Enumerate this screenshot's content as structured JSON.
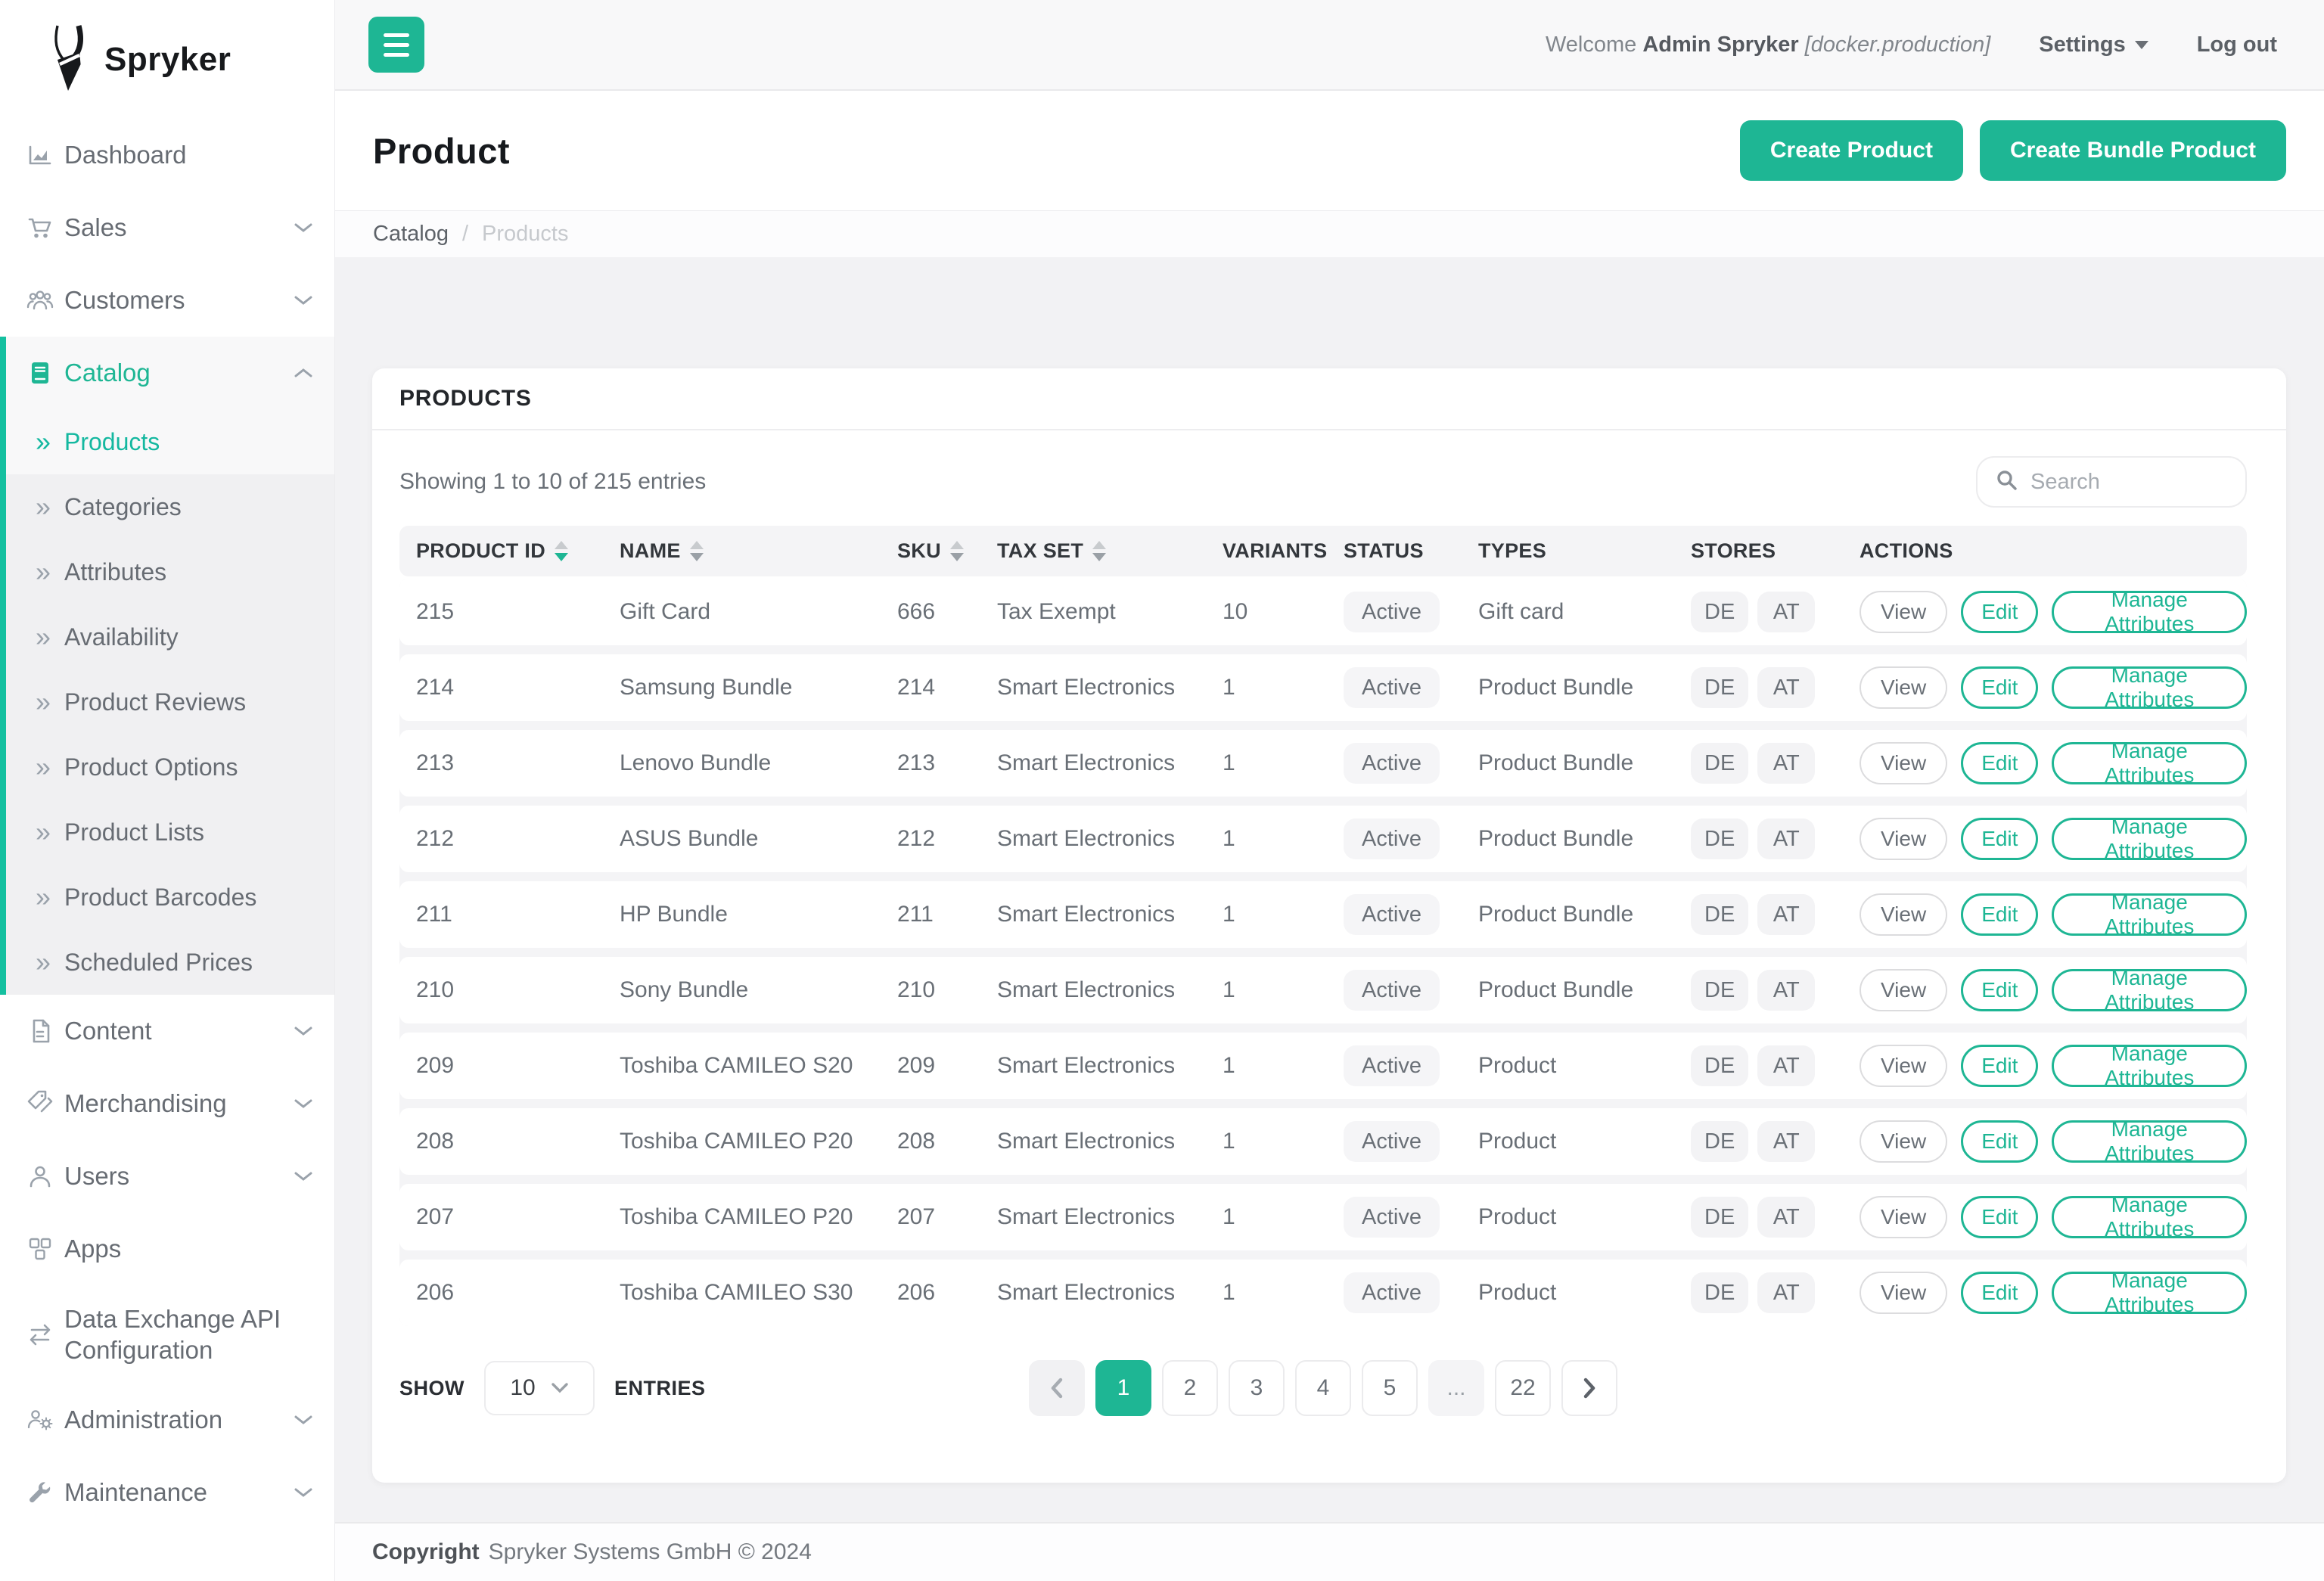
{
  "brand": {
    "logo_text": "Spryker",
    "accent_color": "#1EB694",
    "accent_bar_color": "#15c0a0"
  },
  "topbar": {
    "welcome_prefix": "Welcome",
    "user_name": "Admin Spryker",
    "environment": "[docker.production]",
    "settings_label": "Settings",
    "logout_label": "Log out"
  },
  "sidebar": {
    "top": [
      {
        "label": "Dashboard"
      },
      {
        "label": "Sales"
      },
      {
        "label": "Customers"
      }
    ],
    "catalog": {
      "label": "Catalog",
      "children": [
        {
          "label": "Products"
        },
        {
          "label": "Categories"
        },
        {
          "label": "Attributes"
        },
        {
          "label": "Availability"
        },
        {
          "label": "Product Reviews"
        },
        {
          "label": "Product Options"
        },
        {
          "label": "Product Lists"
        },
        {
          "label": "Product Barcodes"
        },
        {
          "label": "Scheduled Prices"
        }
      ]
    },
    "bottom": [
      {
        "label": "Content"
      },
      {
        "label": "Merchandising"
      },
      {
        "label": "Users"
      },
      {
        "label": "Apps"
      },
      {
        "label": "Data Exchange API Configuration"
      },
      {
        "label": "Administration"
      },
      {
        "label": "Maintenance"
      }
    ]
  },
  "page": {
    "title": "Product",
    "breadcrumb": {
      "parent": "Catalog",
      "separator": "/",
      "current": "Products"
    },
    "create_product_label": "Create Product",
    "create_bundle_label": "Create Bundle Product"
  },
  "panel": {
    "title": "PRODUCTS",
    "showing": "Showing 1 to 10 of 215 entries",
    "search_placeholder": "Search"
  },
  "table": {
    "columns": [
      "PRODUCT ID",
      "NAME",
      "SKU",
      "TAX SET",
      "VARIANTS",
      "STATUS",
      "TYPES",
      "STORES",
      "ACTIONS"
    ],
    "sorted_column": "PRODUCT ID",
    "sorted_direction": "desc",
    "actions": {
      "view": "View",
      "edit": "Edit",
      "manage": "Manage Attributes"
    },
    "rows": [
      {
        "id": "215",
        "name": "Gift Card",
        "sku": "666",
        "tax_set": "Tax Exempt",
        "variants": "10",
        "status": "Active",
        "type": "Gift card",
        "stores": [
          "DE",
          "AT"
        ]
      },
      {
        "id": "214",
        "name": "Samsung Bundle",
        "sku": "214",
        "tax_set": "Smart Electronics",
        "variants": "1",
        "status": "Active",
        "type": "Product Bundle",
        "stores": [
          "DE",
          "AT"
        ]
      },
      {
        "id": "213",
        "name": "Lenovo Bundle",
        "sku": "213",
        "tax_set": "Smart Electronics",
        "variants": "1",
        "status": "Active",
        "type": "Product Bundle",
        "stores": [
          "DE",
          "AT"
        ]
      },
      {
        "id": "212",
        "name": "ASUS Bundle",
        "sku": "212",
        "tax_set": "Smart Electronics",
        "variants": "1",
        "status": "Active",
        "type": "Product Bundle",
        "stores": [
          "DE",
          "AT"
        ]
      },
      {
        "id": "211",
        "name": "HP Bundle",
        "sku": "211",
        "tax_set": "Smart Electronics",
        "variants": "1",
        "status": "Active",
        "type": "Product Bundle",
        "stores": [
          "DE",
          "AT"
        ]
      },
      {
        "id": "210",
        "name": "Sony Bundle",
        "sku": "210",
        "tax_set": "Smart Electronics",
        "variants": "1",
        "status": "Active",
        "type": "Product Bundle",
        "stores": [
          "DE",
          "AT"
        ]
      },
      {
        "id": "209",
        "name": "Toshiba CAMILEO S20",
        "sku": "209",
        "tax_set": "Smart Electronics",
        "variants": "1",
        "status": "Active",
        "type": "Product",
        "stores": [
          "DE",
          "AT"
        ]
      },
      {
        "id": "208",
        "name": "Toshiba CAMILEO P20",
        "sku": "208",
        "tax_set": "Smart Electronics",
        "variants": "1",
        "status": "Active",
        "type": "Product",
        "stores": [
          "DE",
          "AT"
        ]
      },
      {
        "id": "207",
        "name": "Toshiba CAMILEO P20",
        "sku": "207",
        "tax_set": "Smart Electronics",
        "variants": "1",
        "status": "Active",
        "type": "Product",
        "stores": [
          "DE",
          "AT"
        ]
      },
      {
        "id": "206",
        "name": "Toshiba CAMILEO S30",
        "sku": "206",
        "tax_set": "Smart Electronics",
        "variants": "1",
        "status": "Active",
        "type": "Product",
        "stores": [
          "DE",
          "AT"
        ]
      }
    ]
  },
  "pagination": {
    "show_label": "SHOW",
    "entries_label": "ENTRIES",
    "page_size": "10",
    "pages": [
      "1",
      "2",
      "3",
      "4",
      "5",
      "...",
      "22"
    ],
    "active_page": "1"
  },
  "footer": {
    "copyright_label": "Copyright",
    "text": "Spryker Systems GmbH © 2024"
  }
}
